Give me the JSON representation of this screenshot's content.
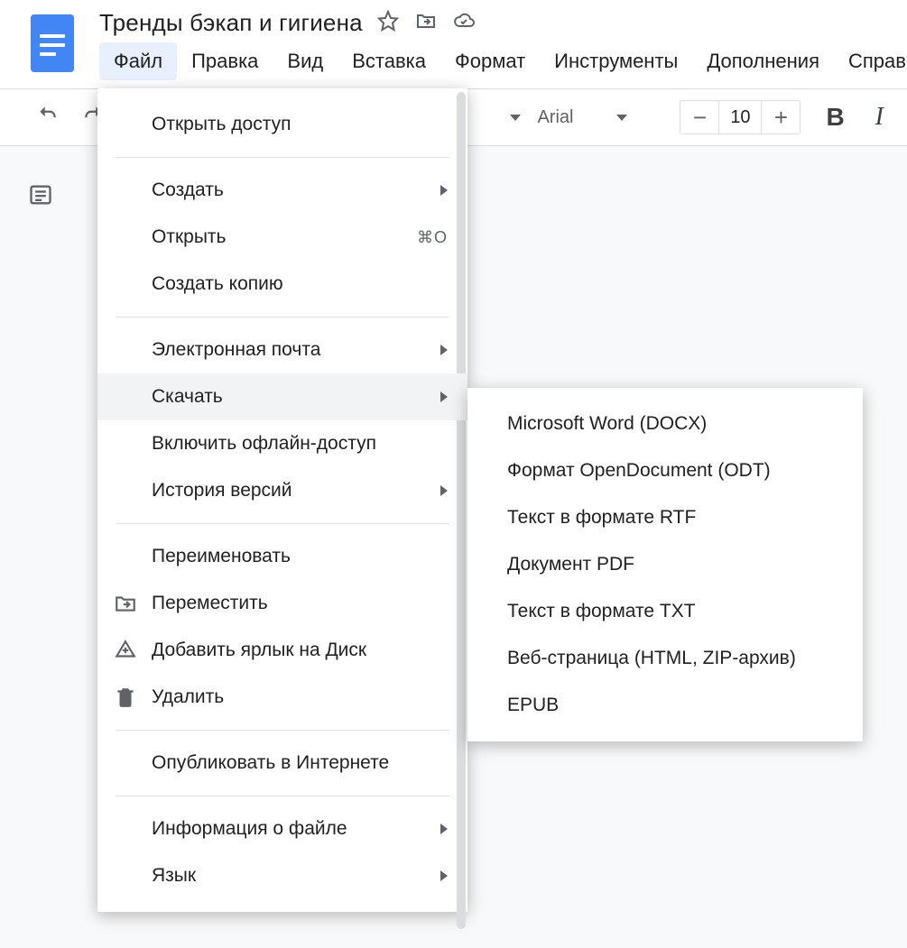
{
  "doc_title": "Тренды бэкап и гигиена",
  "menubar": {
    "file": "Файл",
    "edit": "Правка",
    "view": "Вид",
    "insert": "Вставка",
    "format": "Формат",
    "tools": "Инструменты",
    "addons": "Дополнения",
    "help": "Справка"
  },
  "toolbar": {
    "font_name": "Arial",
    "font_size": "10"
  },
  "file_menu": {
    "share": "Открыть доступ",
    "new": "Создать",
    "open": "Открыть",
    "open_shortcut": "⌘O",
    "make_copy": "Создать копию",
    "email": "Электронная почта",
    "download": "Скачать",
    "offline": "Включить офлайн-доступ",
    "version_history": "История версий",
    "rename": "Переименовать",
    "move": "Переместить",
    "add_shortcut": "Добавить ярлык на Диск",
    "delete": "Удалить",
    "publish": "Опубликовать в Интернете",
    "file_info": "Информация о файле",
    "language": "Язык"
  },
  "download_submenu": {
    "docx": "Microsoft Word (DOCX)",
    "odt": "Формат OpenDocument (ODT)",
    "rtf": "Текст в формате RTF",
    "pdf": "Документ PDF",
    "txt": "Текст в формате TXT",
    "html": "Веб-страница (HTML, ZIP-архив)",
    "epub": "EPUB"
  }
}
